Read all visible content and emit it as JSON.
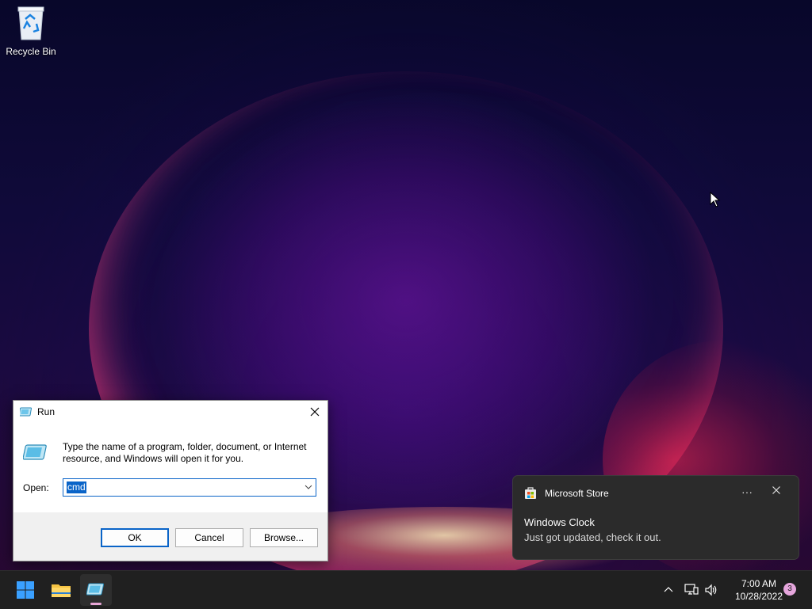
{
  "desktop": {
    "icons": [
      {
        "label": "Recycle Bin",
        "icon": "recycle-bin-icon"
      }
    ]
  },
  "run_dialog": {
    "title": "Run",
    "description": "Type the name of a program, folder, document, or Internet resource, and Windows will open it for you.",
    "open_label": "Open:",
    "open_value": "cmd",
    "buttons": {
      "ok": "OK",
      "cancel": "Cancel",
      "browse": "Browse..."
    }
  },
  "toast": {
    "app": "Microsoft Store",
    "title": "Windows Clock",
    "message": "Just got updated, check it out.",
    "more_label": "···"
  },
  "taskbar": {
    "apps": [
      {
        "name": "start",
        "icon": "windows-logo-icon"
      },
      {
        "name": "file-explorer",
        "icon": "folder-icon"
      },
      {
        "name": "run",
        "icon": "run-icon"
      }
    ],
    "clock": {
      "time": "7:00 AM",
      "date": "10/28/2022"
    },
    "notification_count": "3"
  },
  "colors": {
    "accent": "#0a64c8",
    "taskbar": "#202020",
    "toast_bg": "#2b2b2b",
    "badge": "#e6a6dd"
  }
}
